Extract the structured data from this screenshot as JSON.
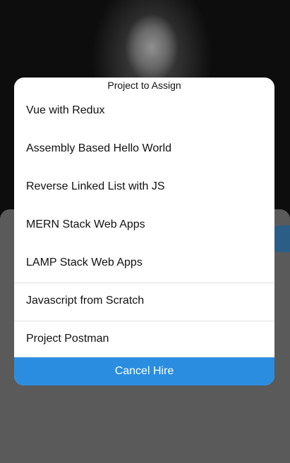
{
  "dialog": {
    "title": "Project to Assign",
    "options": [
      {
        "label": "Vue with Redux"
      },
      {
        "label": "Assembly Based Hello World"
      },
      {
        "label": "Reverse Linked List with JS"
      },
      {
        "label": "MERN Stack Web Apps"
      },
      {
        "label": "LAMP Stack Web Apps"
      },
      {
        "label": "Javascript from Scratch"
      },
      {
        "label": "Project Postman"
      }
    ],
    "cancel_label": "Cancel Hire"
  },
  "colors": {
    "accent": "#2b8ddf",
    "backdrop": "#5a5a5a",
    "dialog_bg": "#ffffff"
  }
}
